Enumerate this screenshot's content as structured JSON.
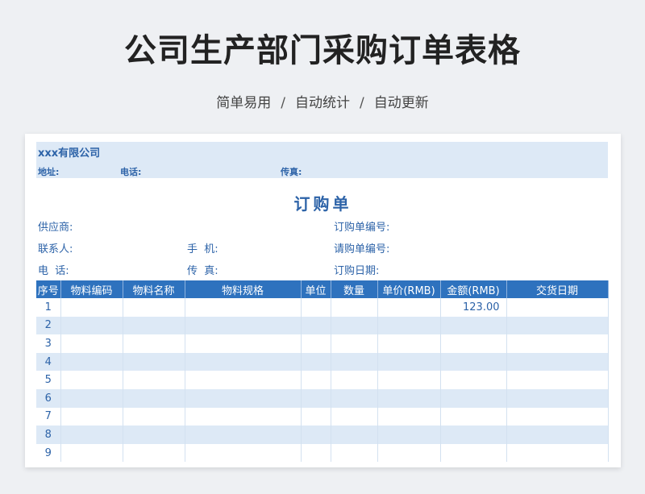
{
  "header": {
    "title": "公司生产部门采购订单表格",
    "subtitle_items": [
      "简单易用",
      "自动统计",
      "自动更新"
    ],
    "subtitle_sep": "/"
  },
  "company": {
    "name": "xxx有限公司",
    "address_label": "地址:",
    "phone_label": "电话:",
    "fax_label": "传真:"
  },
  "order": {
    "title": "订购单",
    "supplier_label": "供应商:",
    "contact_label": "联系人:",
    "tel_label": "电  话:",
    "mobile_label": "手  机:",
    "fax_label": "传  真:",
    "order_no_label": "订购单编号:",
    "request_no_label": "请购单编号:",
    "order_date_label": "订购日期:"
  },
  "table": {
    "columns": [
      "序号",
      "物料编码",
      "物料名称",
      "物料规格",
      "单位",
      "数量",
      "单价(RMB)",
      "金额(RMB)",
      "交货日期"
    ],
    "rows": [
      {
        "no": "1",
        "amount": "123.00"
      },
      {
        "no": "2",
        "amount": ""
      },
      {
        "no": "3",
        "amount": ""
      },
      {
        "no": "4",
        "amount": ""
      },
      {
        "no": "5",
        "amount": ""
      },
      {
        "no": "6",
        "amount": ""
      },
      {
        "no": "7",
        "amount": ""
      },
      {
        "no": "8",
        "amount": ""
      },
      {
        "no": "9",
        "amount": ""
      }
    ]
  },
  "colors": {
    "accent": "#2e72be",
    "text_blue": "#2d63a8",
    "band": "#dde9f6"
  }
}
